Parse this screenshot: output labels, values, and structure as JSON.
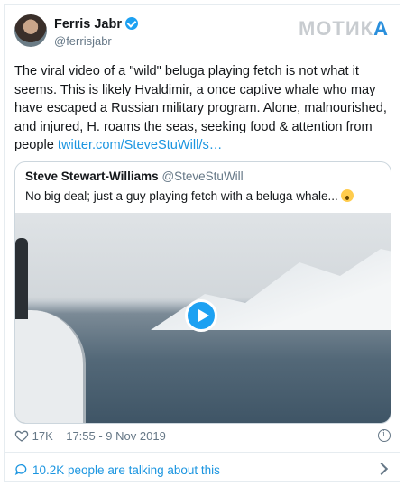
{
  "watermark": {
    "text_a": "МОТИК",
    "text_b": "A"
  },
  "author": {
    "name": "Ferris Jabr",
    "handle": "@ferrisjabr"
  },
  "tweet": {
    "text": "The viral video of a \"wild\" beluga playing fetch is not what it seems. This is likely Hvaldimir, a once captive whale who may have escaped a Russian military program. Alone, malnourished, and injured, H. roams the seas, seeking food & attention from people ",
    "link": "twitter.com/SteveStuWill/s…"
  },
  "quote": {
    "name": "Steve Stewart-Williams",
    "handle": "@SteveStuWill",
    "text": "No big deal; just a guy playing fetch with a beluga whale... "
  },
  "meta": {
    "likes": "17K",
    "timestamp": "17:55 - 9 Nov 2019"
  },
  "footer": {
    "talking": "10.2K people are talking about this"
  },
  "colors": {
    "accent": "#1da1f2",
    "link": "#1b95e0",
    "muted": "#657786"
  }
}
